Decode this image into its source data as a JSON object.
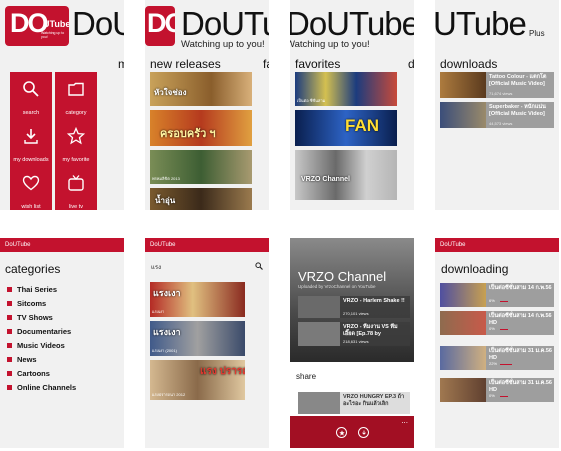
{
  "app": {
    "name": "DoUTube",
    "tagline": "Watching up to you!",
    "plus": "Plus",
    "logo_letters": "DO",
    "logo_name": "UTube",
    "logo_small": "Watching up to you!"
  },
  "home": {
    "menu_peek": "m",
    "tiles": [
      {
        "label": "search",
        "icon": "search-icon"
      },
      {
        "label": "category",
        "icon": "folder-icon"
      },
      {
        "label": "my downloads",
        "icon": "download-icon"
      },
      {
        "label": "my favorite",
        "icon": "star-icon"
      },
      {
        "label": "wish list",
        "icon": "heart-icon"
      },
      {
        "label": "live tv",
        "icon": "tv-icon"
      }
    ]
  },
  "new_releases": {
    "header": "new releases",
    "peek": "fa",
    "items": [
      {
        "title": "หัวใจช่อง",
        "caption": "",
        "color": "#c9a25a"
      },
      {
        "title": "ครอบครัว ฯ",
        "caption": "",
        "color": "#b53a1e"
      },
      {
        "title": "",
        "caption": "พรหมลิขิต 2013",
        "color": "#7a8d56"
      },
      {
        "title": "น้ำอุ่น",
        "caption": "",
        "color": "#7a5a2e"
      }
    ]
  },
  "favorites": {
    "header": "favorites",
    "peek": "d",
    "items": [
      {
        "title": "",
        "caption": "เป็นต่อ ซีซั่นสาม",
        "color": "#1c3c7e"
      },
      {
        "title": "FAN",
        "caption": "",
        "color": "#2d63c5"
      },
      {
        "title": "",
        "caption": "VRZO Channel",
        "color": "#b5b5b5"
      }
    ]
  },
  "downloads": {
    "header": "downloads",
    "items": [
      {
        "title": "Tattoo Colour - แตกโต [Official Music Video]",
        "views": "71,674 views",
        "color": "#ad7b3e"
      },
      {
        "title": "Superbaker - หนักแน่น [Official Music Video]",
        "views": "44,573 views",
        "color": "#3b4e7a"
      }
    ]
  },
  "categories_screen": {
    "bar": "DoUTube",
    "header": "categories",
    "items": [
      "Thai Series",
      "Sitcoms",
      "TV Shows",
      "Documentaries",
      "Music Videos",
      "News",
      "Cartoons",
      "Online Channels"
    ]
  },
  "search_screen": {
    "bar": "DoUTube",
    "query": "แรง",
    "results": [
      {
        "title": "แรงเงา",
        "caption": "แรงเงา",
        "color": "#b42a25"
      },
      {
        "title": "แรงเงา",
        "caption": "แรงเงา (2001)",
        "color": "#405a8a"
      },
      {
        "title": "แรง ปรารถนา",
        "caption": "แรงปรารถนา 2012",
        "color": "#d4b890"
      }
    ]
  },
  "channel_screen": {
    "title": "VRZO Channel",
    "uploaded_by": "Uploaded by VrzoChannel on YouTube",
    "items": [
      {
        "title": "VRZO - Harlem Shake !!",
        "views": "270,101 views"
      },
      {
        "title": "VRZO - ทีมงาน VS ทีมเอี๊ยด [Ep.78 by",
        "views": "218,631 views"
      },
      {
        "title": "VRZO HUNGRY EP.3 ถ้าอะไรอะ กินแล้วเลิก",
        "views": ""
      }
    ],
    "share": "share",
    "more": "..."
  },
  "downloading_screen": {
    "bar": "DoUTube",
    "header": "downloading",
    "items": [
      {
        "title": "เป็นต่อซีซั่นสาม 14 ก.พ.56",
        "progress_text": "6%",
        "progress": 0.06,
        "color": "#4f4fa0"
      },
      {
        "title": "เป็นต่อซีซั่นสาม 14 ก.พ.56 HD",
        "progress_text": "0%",
        "progress": 0.0,
        "color": "#8e6b4e"
      },
      {
        "title": "เป็นต่อซีซั่นสาม 31 ม.ค.56 HD",
        "progress_text": "22%",
        "progress": 0.22,
        "color": "#5a6aa0"
      },
      {
        "title": "เป็นต่อซีซั่นสาม 31 ม.ค.56 HD",
        "progress_text": "0%",
        "progress": 0.0,
        "color": "#a07850"
      }
    ]
  },
  "colors": {
    "brand": "#c3122e",
    "panel_bg": "#f1f1f1"
  }
}
